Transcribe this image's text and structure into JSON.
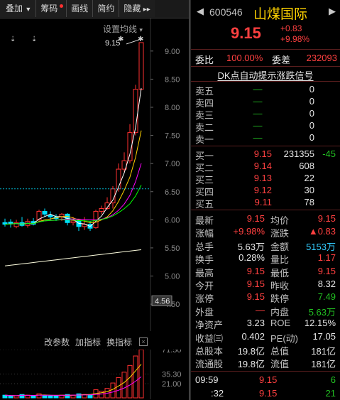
{
  "toolbar": {
    "items": [
      "叠加",
      "筹码",
      "画线",
      "简约",
      "隐藏"
    ],
    "more": "▸▸",
    "chip_dot": true
  },
  "chart": {
    "settings_label": "设置均线",
    "price_flag": "9.15",
    "y_ticks": [
      "9.00",
      "8.50",
      "8.00",
      "7.50",
      "7.00",
      "6.50",
      "6.00",
      "5.50",
      "5.00",
      "4.50"
    ],
    "current_price_tag": "4.56",
    "sub_buttons": [
      "改参数",
      "加指标",
      "换指标"
    ],
    "close_glyph": "×",
    "vol_ticks": [
      "71.50",
      "35.30",
      "21.00"
    ]
  },
  "chart_data": {
    "type": "candlestick",
    "ylim": [
      4.4,
      9.2
    ],
    "candles": [
      {
        "o": 5.95,
        "c": 5.92,
        "h": 6.02,
        "l": 5.88
      },
      {
        "o": 5.96,
        "c": 5.93,
        "h": 6.01,
        "l": 5.86
      },
      {
        "o": 5.88,
        "c": 5.95,
        "h": 6.0,
        "l": 5.85
      },
      {
        "o": 5.95,
        "c": 5.9,
        "h": 6.05,
        "l": 5.88
      },
      {
        "o": 5.9,
        "c": 5.97,
        "h": 6.02,
        "l": 5.86
      },
      {
        "o": 5.97,
        "c": 5.92,
        "h": 6.03,
        "l": 5.9
      },
      {
        "o": 6.0,
        "c": 6.15,
        "h": 6.18,
        "l": 5.96
      },
      {
        "o": 6.15,
        "c": 6.1,
        "h": 6.2,
        "l": 6.05
      },
      {
        "o": 6.08,
        "c": 6.05,
        "h": 6.15,
        "l": 6.0
      },
      {
        "o": 6.05,
        "c": 6.02,
        "h": 6.1,
        "l": 5.98
      },
      {
        "o": 6.05,
        "c": 6.1,
        "h": 6.12,
        "l": 5.98
      },
      {
        "o": 6.1,
        "c": 5.95,
        "h": 6.12,
        "l": 5.9
      },
      {
        "o": 5.95,
        "c": 5.98,
        "h": 6.05,
        "l": 5.9
      },
      {
        "o": 5.98,
        "c": 5.88,
        "h": 6.0,
        "l": 5.8
      },
      {
        "o": 5.88,
        "c": 5.92,
        "h": 6.05,
        "l": 5.82
      },
      {
        "o": 5.92,
        "c": 5.85,
        "h": 5.98,
        "l": 5.8
      },
      {
        "o": 5.86,
        "c": 6.15,
        "h": 6.18,
        "l": 5.84
      },
      {
        "o": 6.15,
        "c": 6.2,
        "h": 6.25,
        "l": 6.1
      },
      {
        "o": 6.2,
        "c": 6.3,
        "h": 6.4,
        "l": 6.18
      },
      {
        "o": 6.3,
        "c": 6.55,
        "h": 6.6,
        "l": 6.2
      },
      {
        "o": 6.55,
        "c": 6.9,
        "h": 7.0,
        "l": 6.5
      },
      {
        "o": 6.9,
        "c": 7.05,
        "h": 7.2,
        "l": 6.85
      },
      {
        "o": 7.05,
        "c": 7.55,
        "h": 7.7,
        "l": 7.0
      },
      {
        "o": 7.55,
        "c": 8.32,
        "h": 8.4,
        "l": 7.5
      },
      {
        "o": 8.32,
        "c": 9.15,
        "h": 9.15,
        "l": 8.3
      }
    ],
    "volumes": [
      4,
      3,
      3,
      5,
      4,
      3,
      6,
      4,
      3,
      3,
      4,
      5,
      4,
      6,
      5,
      5,
      12,
      10,
      14,
      22,
      30,
      38,
      48,
      62,
      71.5
    ],
    "colors": {
      "up": "#ff3030",
      "down": "#00e0ff",
      "ma5": "#ffffff",
      "ma10": "#ffd200",
      "ma20": "#ff00ff",
      "ma30": "#00ff00",
      "ma60": "#ffffe0"
    }
  },
  "quote": {
    "code": "600546",
    "name": "山煤国际",
    "price": "9.15",
    "change": "+0.83",
    "change_pct": "+9.98%",
    "weibi_label": "委比",
    "weibi_value": "100.00%",
    "weicha_label": "委差",
    "weicha_value": "232093",
    "dk_link": "DK点自动提示涨跌信号",
    "asks": [
      {
        "label": "卖五",
        "price": "—",
        "vol": "0"
      },
      {
        "label": "卖四",
        "price": "—",
        "vol": "0"
      },
      {
        "label": "卖三",
        "price": "—",
        "vol": "0"
      },
      {
        "label": "卖二",
        "price": "—",
        "vol": "0"
      },
      {
        "label": "卖一",
        "price": "—",
        "vol": "0"
      }
    ],
    "bids": [
      {
        "label": "买一",
        "price": "9.15",
        "vol": "231355",
        "chg": "-45"
      },
      {
        "label": "买二",
        "price": "9.14",
        "vol": "608",
        "chg": ""
      },
      {
        "label": "买三",
        "price": "9.13",
        "vol": "22",
        "chg": ""
      },
      {
        "label": "买四",
        "price": "9.12",
        "vol": "30",
        "chg": ""
      },
      {
        "label": "买五",
        "price": "9.11",
        "vol": "78",
        "chg": ""
      }
    ],
    "stats": [
      {
        "l1": "最新",
        "v1": "9.15",
        "c1": "red",
        "l2": "均价",
        "v2": "9.15",
        "c2": "red"
      },
      {
        "l1": "涨幅",
        "v1": "+9.98%",
        "c1": "red",
        "l2": "涨跌",
        "v2": "▲0.83",
        "c2": "red"
      },
      {
        "l1": "总手",
        "v1": "5.63万",
        "c1": "white",
        "l2": "金额",
        "v2": "5153万",
        "c2": "cyan"
      },
      {
        "l1": "换手",
        "v1": "0.28%",
        "c1": "white",
        "l2": "量比",
        "v2": "1.17",
        "c2": "red"
      },
      {
        "l1": "最高",
        "v1": "9.15",
        "c1": "red",
        "l2": "最低",
        "v2": "9.15",
        "c2": "red"
      },
      {
        "l1": "今开",
        "v1": "9.15",
        "c1": "red",
        "l2": "昨收",
        "v2": "8.32",
        "c2": "white"
      },
      {
        "l1": "涨停",
        "v1": "9.15",
        "c1": "red",
        "l2": "跌停",
        "v2": "7.49",
        "c2": "green"
      },
      {
        "l1": "外盘",
        "v1": "—",
        "c1": "red",
        "l2": "内盘",
        "v2": "5.63万",
        "c2": "green"
      },
      {
        "l1": "净资产",
        "v1": "3.23",
        "c1": "white",
        "l2": "ROE",
        "v2": "12.15%",
        "c2": "white"
      },
      {
        "l1": "收益㈢",
        "v1": "0.402",
        "c1": "white",
        "l2": "PE(动)",
        "v2": "17.05",
        "c2": "white"
      },
      {
        "l1": "总股本",
        "v1": "19.8亿",
        "c1": "white",
        "l2": "总值",
        "v2": "181亿",
        "c2": "white"
      },
      {
        "l1": "流通股",
        "v1": "19.8亿",
        "c1": "white",
        "l2": "流值",
        "v2": "181亿",
        "c2": "white"
      }
    ],
    "ticks": [
      {
        "time": "09:59",
        "price": "9.15",
        "vol": "6"
      },
      {
        "time": ":32",
        "price": "9.15",
        "vol": "21"
      }
    ]
  }
}
